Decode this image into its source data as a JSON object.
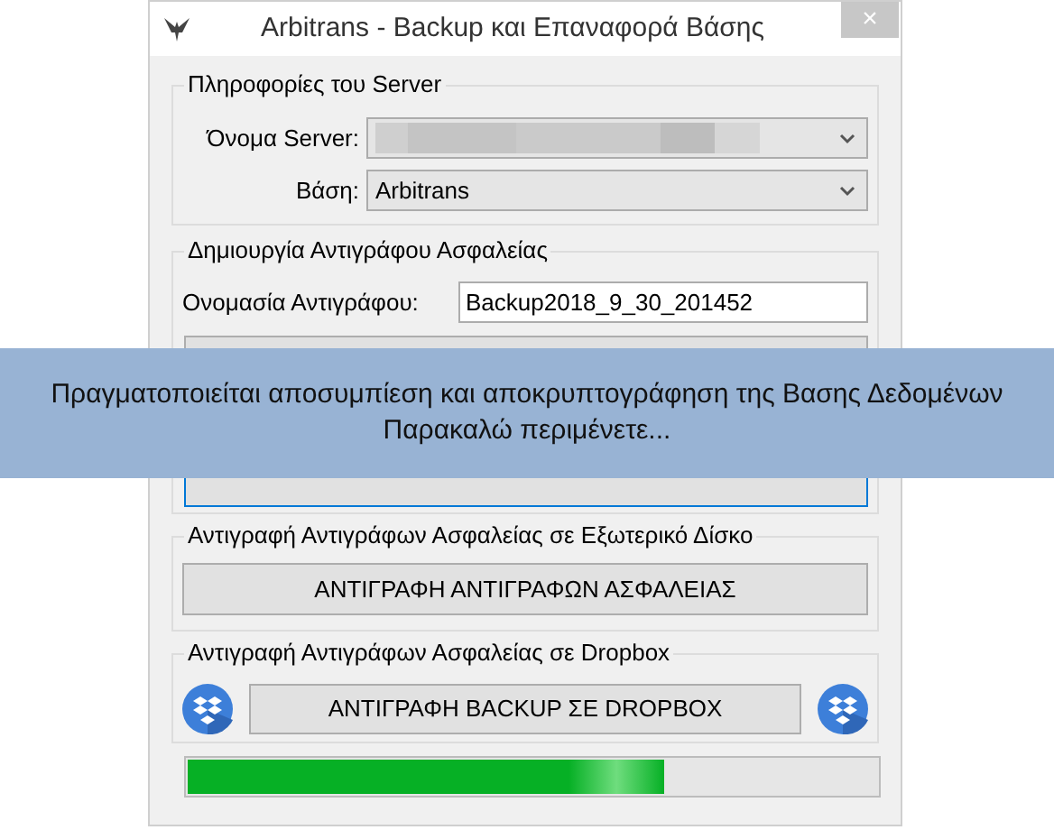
{
  "window": {
    "title": "Arbitrans - Backup και Επαναφορά Βάσης",
    "close": "×"
  },
  "server_info": {
    "legend": "Πληροφορίες του Server",
    "server_label": "Όνομα Server:",
    "database_label": "Βάση:",
    "database_value": "Arbitrans"
  },
  "backup": {
    "legend": "Δημιουργία Αντιγράφου Ασφαλείας",
    "name_label": "Ονομασία Αντιγράφου:",
    "name_value": "Backup2018_9_30_201452"
  },
  "external_disk": {
    "legend": "Αντιγραφή Αντιγράφων Ασφαλείας σε Εξωτερικό Δίσκο",
    "button": "ΑΝΤΙΓΡΑΦΗ ΑΝΤΙΓΡΑΦΩΝ ΑΣΦΑΛΕΙΑΣ"
  },
  "dropbox": {
    "legend": "Αντιγραφή Αντιγράφων Ασφαλείας σε Dropbox",
    "button": "ΑΝΤΙΓΡΑΦΗ BACKUP ΣΕ DROPBOX"
  },
  "progress": {
    "level": 0.69
  },
  "banner": {
    "lines": [
      "Πραγματοποιείται αποσυμπίεση και αποκρυπτογράφηση της Βασης Δεδομένων",
      "Παρακαλώ περιμένετε..."
    ]
  }
}
